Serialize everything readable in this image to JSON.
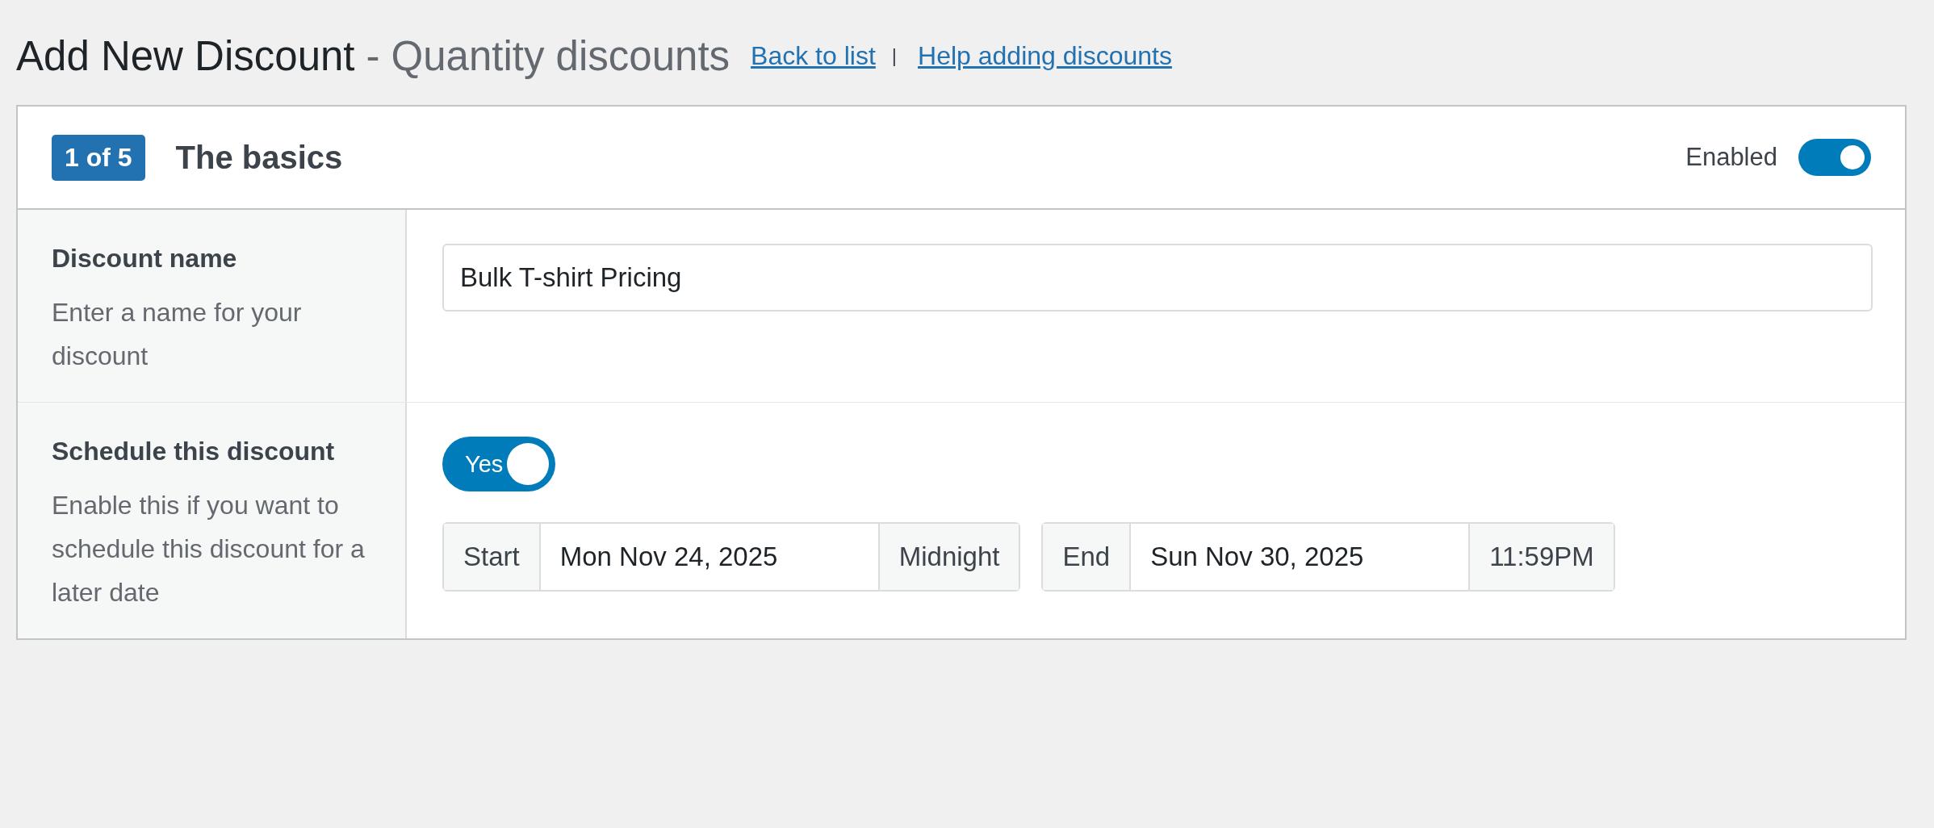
{
  "page_title": {
    "main": "Add New Discount",
    "separator": "-",
    "subtitle": "Quantity discounts"
  },
  "header_links": [
    {
      "label": "Back to list"
    },
    {
      "label": "Help adding discounts"
    }
  ],
  "link_separator": "|",
  "card": {
    "step_badge": "1 of 5",
    "title": "The basics",
    "enabled": {
      "label": "Enabled",
      "on": true
    }
  },
  "rows": [
    {
      "kind": "text",
      "label": "Discount name",
      "description": "Enter a name for your discount",
      "value": "Bulk T-shirt Pricing"
    },
    {
      "kind": "schedule",
      "label": "Schedule this discount",
      "description": "Enable this if you want to schedule this discount for a later date",
      "toggle": {
        "label": "Yes",
        "on": true
      },
      "ranges": [
        {
          "prefix": "Start",
          "date": "Mon Nov 24, 2025",
          "time": "Midnight"
        },
        {
          "prefix": "End",
          "date": "Sun Nov 30, 2025",
          "time": "11:59PM"
        }
      ]
    }
  ]
}
